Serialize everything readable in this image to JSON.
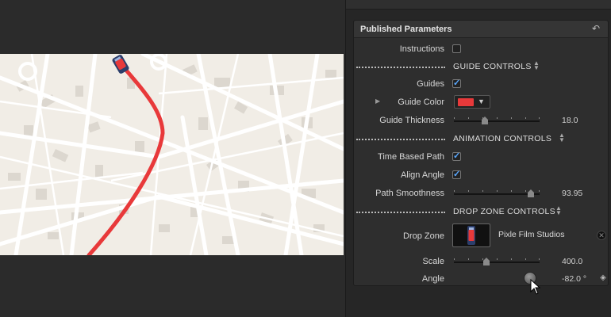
{
  "panel": {
    "title": "Published Parameters"
  },
  "rows": {
    "instructions": {
      "label": "Instructions",
      "checked": false
    },
    "guide_group": {
      "title": "GUIDE CONTROLS"
    },
    "guides": {
      "label": "Guides",
      "checked": true
    },
    "guide_color": {
      "label": "Guide Color",
      "color": "#e8393a"
    },
    "guide_thickness": {
      "label": "Guide Thickness",
      "value": "18.0",
      "fraction": 0.36
    },
    "anim_group": {
      "title": "ANIMATION CONTROLS"
    },
    "time_based_path": {
      "label": "Time Based Path",
      "checked": true
    },
    "align_angle": {
      "label": "Align Angle",
      "checked": true
    },
    "path_smoothness": {
      "label": "Path Smoothness",
      "value": "93.95",
      "fraction": 0.9
    },
    "drop_group": {
      "title": "DROP ZONE CONTROLS"
    },
    "drop_zone": {
      "label": "Drop Zone",
      "name": "Pixle Film Studios"
    },
    "scale": {
      "label": "Scale",
      "value": "400.0",
      "fraction": 0.38
    },
    "angle": {
      "label": "Angle",
      "value": "-82.0 °"
    }
  },
  "colors": {
    "route": "#e8393a",
    "map_bg": "#f1ede6",
    "road": "#ffffff",
    "block": "#d9d4cc",
    "accent": "#5aa8ff"
  },
  "icons": [
    "reset-arrow-icon",
    "checkmark-icon",
    "disclosure-triangle-icon",
    "dropdown-arrow-icon",
    "up-down-arrows-icon",
    "clear-x-icon",
    "keyframe-diamond-icon",
    "pointer-cursor-icon",
    "car-icon"
  ]
}
